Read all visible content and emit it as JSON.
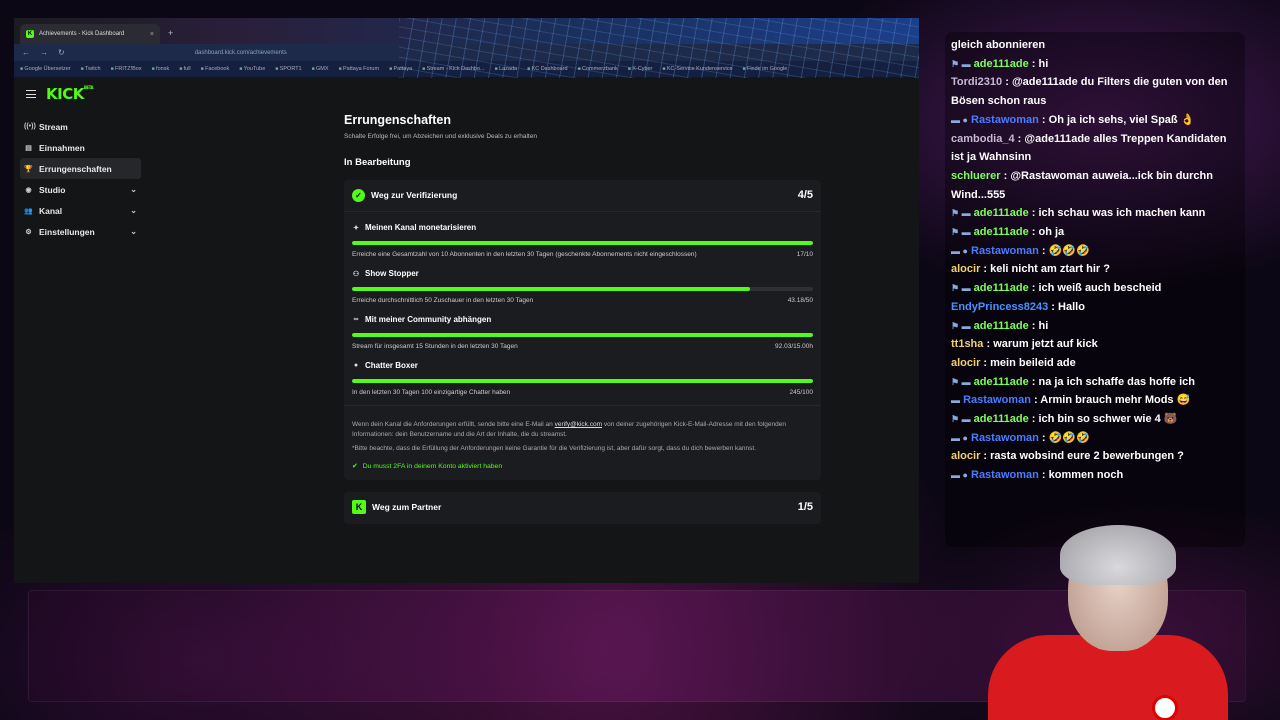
{
  "browser": {
    "tab_title": "Achievements - Kick Dashboard",
    "tab_close": "×",
    "new_tab": "+",
    "url": "dashboard.kick.com/achievements",
    "bookmarks": [
      "Google Übersetzer",
      "Twitch",
      "FRITZ!Box",
      "fonsk",
      "full",
      "Facebook",
      "YouTube",
      "SPORT1",
      "GMX",
      "Pattaya Forum",
      "Pattaya",
      "Stream - Kick Dashbo...",
      "Lazada",
      "KC Dashboard",
      "Commerzbank",
      "X-Cyber",
      "KC-Service Kundenservice",
      "Finde im Google"
    ]
  },
  "app": {
    "logo": "KICK",
    "logo_badge": "BETA",
    "sidebar": [
      {
        "label": "Stream",
        "icon": "broadcast-icon",
        "glyph": "((•))",
        "expandable": false,
        "active": false
      },
      {
        "label": "Einnahmen",
        "icon": "wallet-icon",
        "glyph": "▤",
        "expandable": false,
        "active": false
      },
      {
        "label": "Errungenschaften",
        "icon": "trophy-icon",
        "glyph": "🏆",
        "expandable": false,
        "active": true
      },
      {
        "label": "Studio",
        "icon": "palette-icon",
        "glyph": "◉",
        "expandable": true,
        "active": false
      },
      {
        "label": "Kanal",
        "icon": "users-icon",
        "glyph": "👥",
        "expandable": true,
        "active": false
      },
      {
        "label": "Einstellungen",
        "icon": "gear-icon",
        "glyph": "⚙",
        "expandable": true,
        "active": false
      }
    ],
    "page_title": "Errungenschaften",
    "page_subtitle": "Schalte Erfolge frei, um Abzeichen und exklusive Deals zu erhalten",
    "section_title": "In Bearbeitung",
    "verification": {
      "title": "Weg zur Verifizierung",
      "count": "4/5",
      "tasks": [
        {
          "title": "Meinen Kanal monetarisieren",
          "icon": "sparkle-icon",
          "glyph": "✦",
          "desc": "Erreiche eine Gesamtzahl von 10 Abonnenten in den letzten 30 Tagen (geschenkte Abonnements nicht eingeschlossen)",
          "progress_text": "17/10",
          "progress": 1.0
        },
        {
          "title": "Show Stopper",
          "icon": "people-icon",
          "glyph": "⚇",
          "desc": "Erreiche durchschnittlich 50 Zuschauer in den letzten 30 Tagen",
          "progress_text": "43.18/50",
          "progress": 0.8636
        },
        {
          "title": "Mit meiner Community abhängen",
          "icon": "infinity-icon",
          "glyph": "∞",
          "desc": "Stream für insgesamt 15 Stunden in den letzten 30 Tagen",
          "progress_text": "92.03/15.00h",
          "progress": 1.0
        },
        {
          "title": "Chatter Boxer",
          "icon": "chat-bubble-icon",
          "glyph": "●",
          "desc": "In den letzten 30 Tagen 100 einzigartige Chatter haben",
          "progress_text": "245/100",
          "progress": 1.0
        }
      ],
      "note_before_mail": "Wenn dein Kanal die Anforderungen erfüllt, sende bitte eine E-Mail an ",
      "note_mail": "verify@kick.com",
      "note_after_mail": " von deiner zugehörigen Kick-E-Mail-Adresse mit den folgenden Informationen: dein Benutzername und die Art der Inhalte, die du streamst.",
      "note_disclaimer": "*Bitte beachte, dass die Erfüllung der Anforderungen keine Garantie für die Verifizierung ist, aber dafür sorgt, dass du dich bewerben kannst.",
      "check_text": "Du musst 2FA in deinem Konto aktiviert haben",
      "check_glyph": "✔"
    },
    "partner": {
      "title": "Weg zum Partner",
      "count": "1/5",
      "glyph": "K"
    }
  },
  "chat": {
    "messages": [
      {
        "badges": "",
        "user": "",
        "user_color": "#ffffff",
        "text": "gleich abonnieren"
      },
      {
        "badges": "⚑ ▬",
        "user": "ade111ade",
        "user_color": "#7dff5a",
        "text": ": hi"
      },
      {
        "badges": "",
        "user": "Tordi2310",
        "user_color": "#c8b8d8",
        "text": ": @ade111ade du Filters die guten von den Bösen schon raus"
      },
      {
        "badges": "▬ ●",
        "user": "Rastawoman",
        "user_color": "#4a7cff",
        "text": ": Oh ja ich sehs, viel Spaß 👌"
      },
      {
        "badges": "",
        "user": "cambodia_4",
        "user_color": "#c8b8d8",
        "text": ": @ade111ade alles Treppen Kandidaten ist ja Wahnsinn"
      },
      {
        "badges": "",
        "user": "schluerer",
        "user_color": "#7dff5a",
        "text": ": @Rastawoman auweia...ick bin durchn Wind...555"
      },
      {
        "badges": "⚑ ▬",
        "user": "ade111ade",
        "user_color": "#7dff5a",
        "text": ": ich schau was ich machen kann"
      },
      {
        "badges": "⚑ ▬",
        "user": "ade111ade",
        "user_color": "#7dff5a",
        "text": ": oh ja"
      },
      {
        "badges": "▬ ●",
        "user": "Rastawoman",
        "user_color": "#4a7cff",
        "text": ": 🤣🤣🤣"
      },
      {
        "badges": "",
        "user": "alocir",
        "user_color": "#f0d070",
        "text": ": keli nicht am ztart hir ?"
      },
      {
        "badges": "⚑ ▬",
        "user": "ade111ade",
        "user_color": "#7dff5a",
        "text": ": ich weiß auch bescheid"
      },
      {
        "badges": "",
        "user": "EndyPrincess8243",
        "user_color": "#4a90ff",
        "text": ": Hallo"
      },
      {
        "badges": "⚑ ▬",
        "user": "ade111ade",
        "user_color": "#7dff5a",
        "text": ": hi"
      },
      {
        "badges": "",
        "user": "tt1sha",
        "user_color": "#f0d070",
        "text": ": warum jetzt auf kick"
      },
      {
        "badges": "",
        "user": "alocir",
        "user_color": "#f0d070",
        "text": ": mein beileid ade"
      },
      {
        "badges": "⚑ ▬",
        "user": "ade111ade",
        "user_color": "#7dff5a",
        "text": ": na ja ich schaffe das hoffe ich"
      },
      {
        "badges": "▬",
        "user": "Rastawoman",
        "user_color": "#4a7cff",
        "text": ": Armin brauch mehr Mods 😅"
      },
      {
        "badges": "⚑ ▬",
        "user": "ade111ade",
        "user_color": "#7dff5a",
        "text": ": ich bin so schwer wie 4 🐻"
      },
      {
        "badges": "▬ ●",
        "user": "Rastawoman",
        "user_color": "#4a7cff",
        "text": ": 🤣🤣🤣"
      },
      {
        "badges": "",
        "user": "alocir",
        "user_color": "#f0d070",
        "text": ": rasta wobsind eure 2 bewerbungen ?"
      },
      {
        "badges": "▬ ●",
        "user": "Rastawoman",
        "user_color": "#4a7cff",
        "text": ": kommen noch"
      }
    ]
  }
}
